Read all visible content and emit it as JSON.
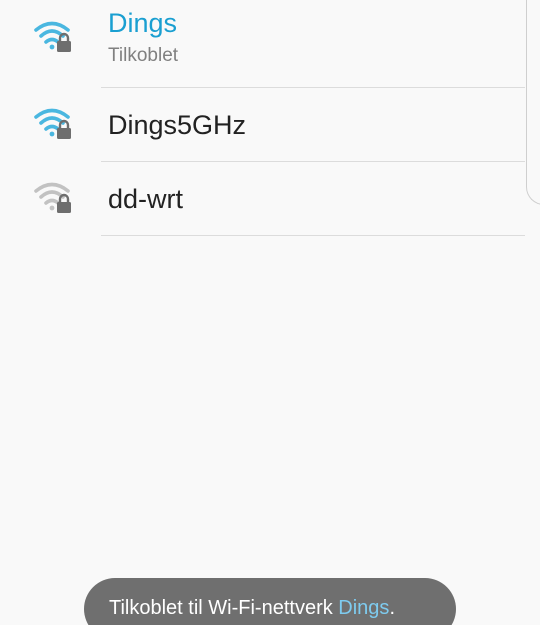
{
  "networks": [
    {
      "name": "Dings",
      "status": "Tilkoblet",
      "connected": true,
      "icon": "wifi-lock-icon",
      "signal_color": "#4ab7e0"
    },
    {
      "name": "Dings5GHz",
      "status": "",
      "connected": false,
      "icon": "wifi-lock-icon",
      "signal_color": "#4ab7e0"
    },
    {
      "name": "dd-wrt",
      "status": "",
      "connected": false,
      "icon": "wifi-lock-icon",
      "signal_color": "#c2c2c2"
    }
  ],
  "toast": {
    "prefix": "Tilkoblet til Wi-Fi-nettverk ",
    "network": "Dings",
    "suffix": "."
  },
  "colors": {
    "accent": "#1a9fd1",
    "lock": "#6e6e6e",
    "background": "#f9f9f9",
    "toast_bg": "#6f6f6f",
    "toast_highlight": "#7ecbef"
  }
}
